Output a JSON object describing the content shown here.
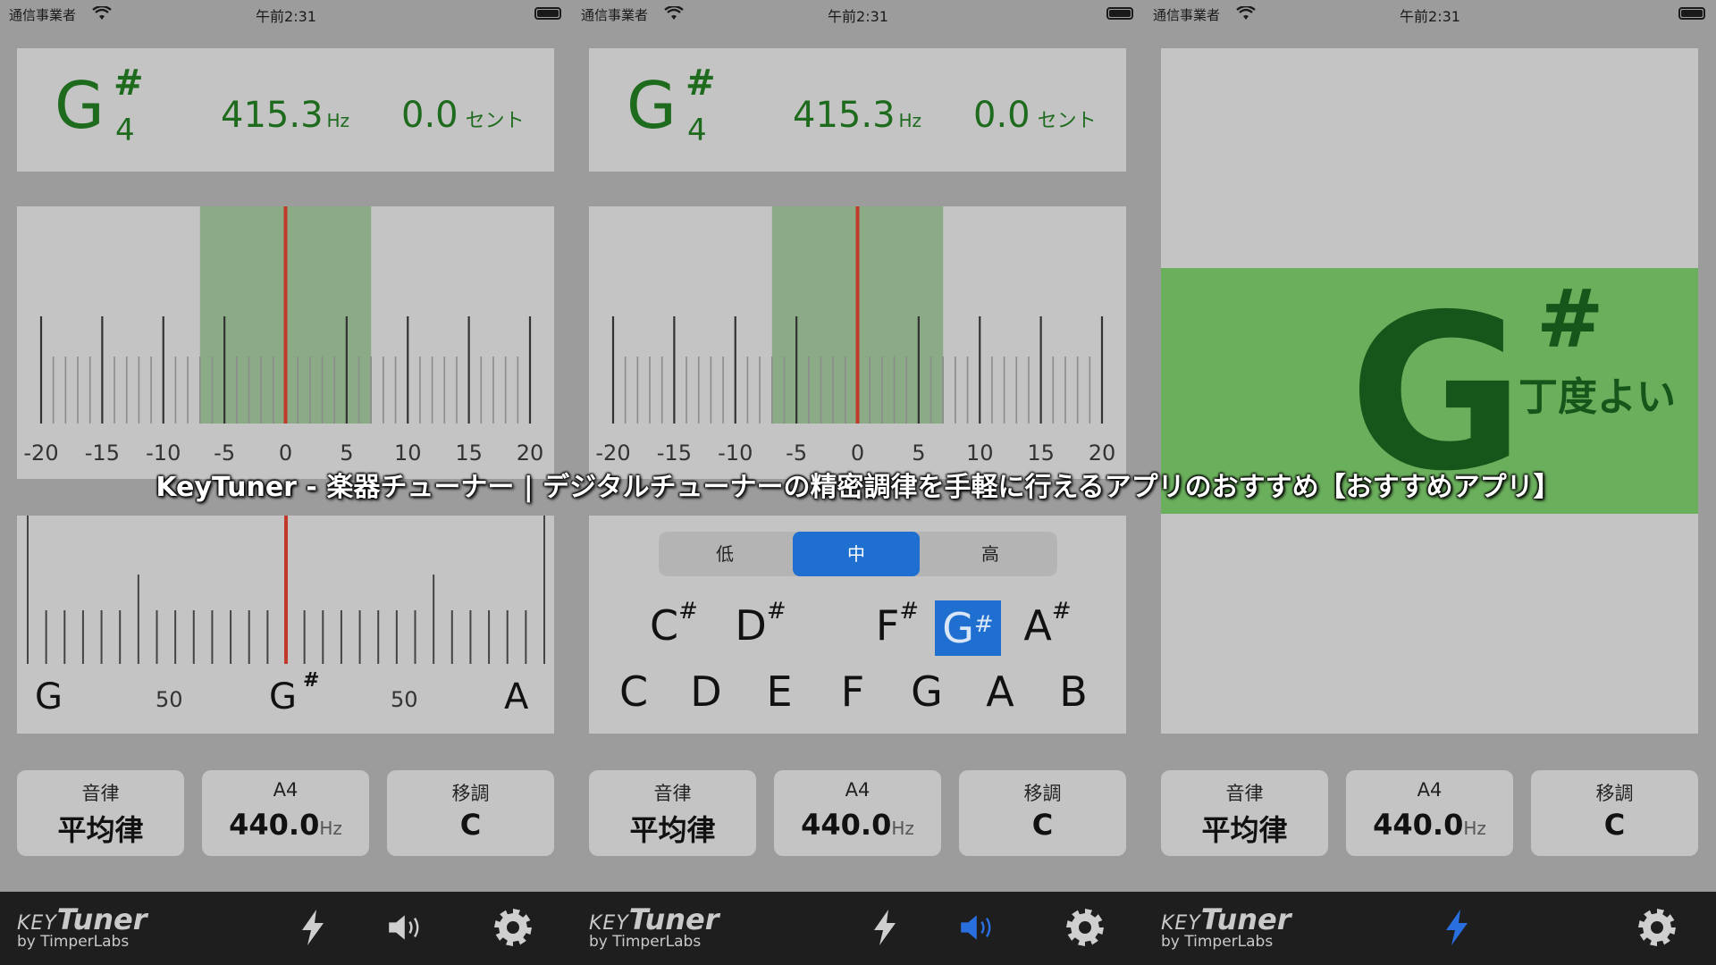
{
  "status": {
    "carrier": "通信事業者",
    "time": "午前2:31"
  },
  "reading": {
    "note": "G",
    "sharp": "#",
    "octave": "4",
    "freq": "415.3",
    "freq_unit": "Hz",
    "cents": "0.0",
    "cents_unit": "セント"
  },
  "meter": {
    "labels": [
      "-20",
      "-15",
      "-10",
      "-5",
      "0",
      "5",
      "10",
      "15",
      "20"
    ]
  },
  "lower_scale": {
    "left": "G",
    "mid_left": "50",
    "center": "G",
    "center_sharp": "#",
    "mid_right": "50",
    "right": "A"
  },
  "range": {
    "low": "低",
    "mid": "中",
    "high": "高",
    "selected": "中"
  },
  "keys": {
    "sharps": [
      {
        "n": "C",
        "s": "#"
      },
      {
        "n": "D",
        "s": "#"
      },
      {
        "n": "F",
        "s": "#"
      },
      {
        "n": "G",
        "s": "#"
      },
      {
        "n": "A",
        "s": "#"
      }
    ],
    "naturals": [
      "C",
      "D",
      "E",
      "F",
      "G",
      "A",
      "B"
    ],
    "selected": "G#"
  },
  "settings": {
    "temperament": {
      "label": "音律",
      "value": "平均律"
    },
    "a4": {
      "label": "A4",
      "value": "440.0",
      "unit": "Hz"
    },
    "transpose": {
      "label": "移調",
      "value": "C"
    }
  },
  "tuned": {
    "note": "G",
    "sharp": "#",
    "text": "丁度よい"
  },
  "logo": {
    "key": "KEY",
    "tuner": "Tuner",
    "by": "by TimperLabs"
  },
  "icons": {
    "lightning": "lightning-icon",
    "speaker": "speaker-icon",
    "gear": "gear-icon"
  },
  "colors": {
    "accent": "#1f6fd1",
    "note_green": "#1e6b1e",
    "in_tune": "#6aaf5c",
    "needle": "#c0392b"
  },
  "overlay": "KeyTuner - 楽器チューナー | デジタルチューナーの精密調律を手軽に行えるアプリのおすすめ【おすすめアプリ】"
}
